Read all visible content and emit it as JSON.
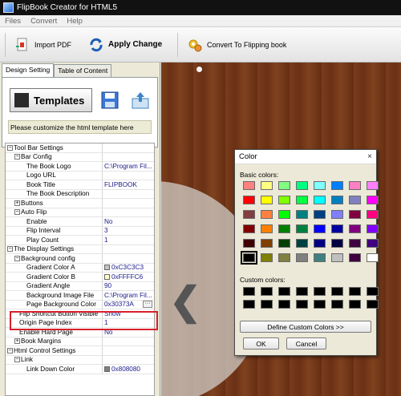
{
  "window": {
    "title": "FlipBook Creator for HTML5"
  },
  "menu": [
    "Files",
    "Convert",
    "Help"
  ],
  "toolbar": {
    "import_label": "Import PDF",
    "apply_label": "Apply Change",
    "convert_label": "Convert To Flipping book"
  },
  "tabs": [
    "Design Setting",
    "Table of Content"
  ],
  "design": {
    "templates_label": "Templates",
    "hint": "Please customize the html template here"
  },
  "properties": [
    {
      "indent": 0,
      "exp": "-",
      "key": "Tool Bar Settings",
      "value": ""
    },
    {
      "indent": 1,
      "exp": "-",
      "key": "Bar Config",
      "value": ""
    },
    {
      "indent": 2,
      "exp": "",
      "key": "The Book Logo",
      "value": "C:\\Program Fil..."
    },
    {
      "indent": 2,
      "exp": "",
      "key": "Logo URL",
      "value": ""
    },
    {
      "indent": 2,
      "exp": "",
      "key": "Book Title",
      "value": "FLIPBOOK"
    },
    {
      "indent": 2,
      "exp": "",
      "key": "The Book Description",
      "value": ""
    },
    {
      "indent": 1,
      "exp": "+",
      "key": "Buttons",
      "value": ""
    },
    {
      "indent": 1,
      "exp": "-",
      "key": "Auto Flip",
      "value": ""
    },
    {
      "indent": 2,
      "exp": "",
      "key": "Enable",
      "value": "No"
    },
    {
      "indent": 2,
      "exp": "",
      "key": "Flip Interval",
      "value": "3"
    },
    {
      "indent": 2,
      "exp": "",
      "key": "Play Count",
      "value": "1"
    },
    {
      "indent": 0,
      "exp": "-",
      "key": "The Display Settings",
      "value": ""
    },
    {
      "indent": 1,
      "exp": "-",
      "key": "Background config",
      "value": ""
    },
    {
      "indent": 2,
      "exp": "",
      "key": "Gradient Color A",
      "value": "0xC3C3C3",
      "swatch": "#c3c3c3"
    },
    {
      "indent": 2,
      "exp": "",
      "key": "Gradient Color B",
      "value": "0xFFFFC6",
      "swatch": "#ffffc6"
    },
    {
      "indent": 2,
      "exp": "",
      "key": "Gradient Angle",
      "value": "90"
    },
    {
      "indent": 2,
      "exp": "",
      "key": "Background Image File",
      "value": "C:\\Program Fil..."
    },
    {
      "indent": 2,
      "exp": "",
      "key": "Page Background Color",
      "value": "0x30373A",
      "dots": true
    },
    {
      "indent": 1,
      "exp": "",
      "key": "Flip Shortcut Button Visible",
      "value": "Show"
    },
    {
      "indent": 1,
      "exp": "",
      "key": "Origin Page Index",
      "value": "1"
    },
    {
      "indent": 1,
      "exp": "",
      "key": "Enable Hard Page",
      "value": "No"
    },
    {
      "indent": 1,
      "exp": "+",
      "key": "Book Margins",
      "value": ""
    },
    {
      "indent": 0,
      "exp": "-",
      "key": "Html Control Settings",
      "value": ""
    },
    {
      "indent": 1,
      "exp": "-",
      "key": "Link",
      "value": ""
    },
    {
      "indent": 2,
      "exp": "",
      "key": "Link Down Color",
      "value": "0x808080",
      "swatch": "#808080"
    }
  ],
  "color_dialog": {
    "title": "Color",
    "close_symbol": "×",
    "basic_label": "Basic colors:",
    "custom_label": "Custom colors:",
    "define_label": "Define Custom Colors >>",
    "ok_label": "OK",
    "cancel_label": "Cancel",
    "basic_colors": [
      "#ff8080",
      "#ffff80",
      "#80ff80",
      "#00ff80",
      "#80ffff",
      "#0080ff",
      "#ff80c0",
      "#ff80ff",
      "#ff0000",
      "#ffff00",
      "#80ff00",
      "#00ff40",
      "#00ffff",
      "#0080c0",
      "#8080c0",
      "#ff00ff",
      "#804040",
      "#ff8040",
      "#00ff00",
      "#008080",
      "#004080",
      "#8080ff",
      "#800040",
      "#ff0080",
      "#800000",
      "#ff8000",
      "#008000",
      "#008040",
      "#0000ff",
      "#0000a0",
      "#800080",
      "#8000ff",
      "#400000",
      "#804000",
      "#004000",
      "#004040",
      "#000080",
      "#000040",
      "#400040",
      "#400080",
      "#000000",
      "#808000",
      "#808040",
      "#808080",
      "#408080",
      "#c0c0c0",
      "#400040",
      "#ffffff"
    ],
    "selected_index": 40
  }
}
